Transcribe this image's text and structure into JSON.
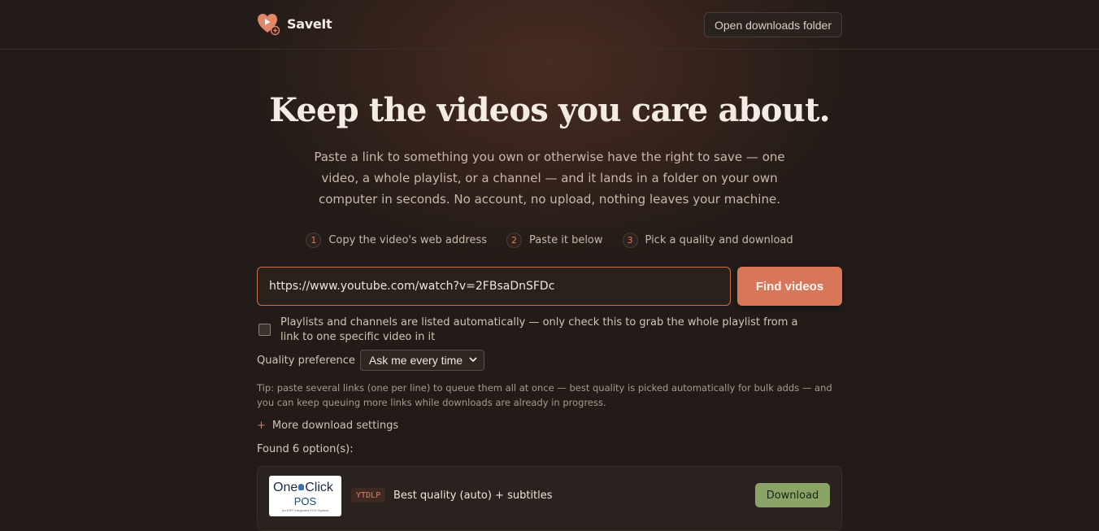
{
  "app": {
    "name": "SaveIt",
    "open_folder_label": "Open downloads folder"
  },
  "hero": {
    "title": "Keep the videos you care about.",
    "subtitle": "Paste a link to something you own or otherwise have the right to save — one video, a whole playlist, or a channel — and it lands in a folder on your own computer in seconds. No account, no upload, nothing leaves your machine."
  },
  "steps": [
    {
      "num": "1",
      "label": "Copy the video's web address"
    },
    {
      "num": "2",
      "label": "Paste it below"
    },
    {
      "num": "3",
      "label": "Pick a quality and download"
    }
  ],
  "search": {
    "value": "https://www.youtube.com/watch?v=2FBsaDnSFDc",
    "button_label": "Find videos"
  },
  "playlist_option": {
    "checked": false,
    "label": "Playlists and channels are listed automatically — only check this to grab the whole playlist from a link to one specific video in it"
  },
  "quality": {
    "label": "Quality preference",
    "selected": "Ask me every time"
  },
  "tip": "Tip: paste several links (one per line) to queue them all at once — best quality is picked automatically for bulk adds — and you can keep queuing more links while downloads are already in progress.",
  "more_settings": {
    "icon": "+",
    "label": "More download settings"
  },
  "results": {
    "summary": "Found 6 option(s):",
    "items": [
      {
        "thumb_line1_a": "One",
        "thumb_line1_b": "Click",
        "thumb_line2": "POS",
        "thumb_line3": "An ERP Integrated POS System",
        "source": "YTDLP",
        "title": "Best quality (auto) + subtitles",
        "action_label": "Download"
      }
    ]
  },
  "colors": {
    "accent": "#d8765a",
    "download": "#8aa366",
    "background": "#221b17"
  }
}
